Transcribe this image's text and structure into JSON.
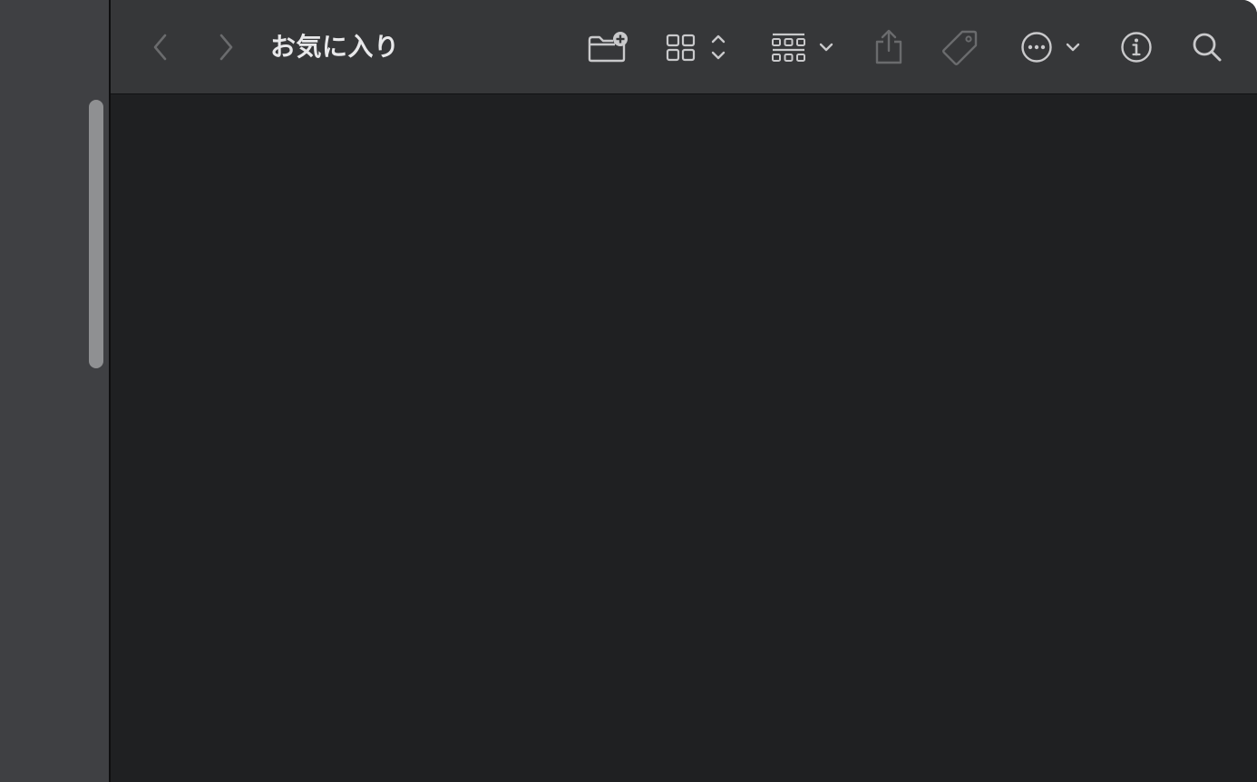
{
  "window": {
    "title": "お気に入り"
  },
  "toolbar": {
    "icons": {
      "back": "chevron-left-icon",
      "forward": "chevron-right-icon",
      "new_folder": "folder-plus-icon",
      "view_mode": "grid-view-icon",
      "group": "group-by-icon",
      "share": "share-icon",
      "tag": "tag-icon",
      "more": "ellipsis-circle-icon",
      "info": "info-circle-icon",
      "search": "search-icon"
    }
  },
  "colors": {
    "sidebar_bg": "#3f4043",
    "toolbar_bg": "#363739",
    "content_bg": "#1f2022",
    "icon_active": "#c9c9cb",
    "icon_disabled": "#6a6b6d",
    "title_text": "#e8e8ea",
    "scrollbar_thumb": "#8f9092"
  }
}
